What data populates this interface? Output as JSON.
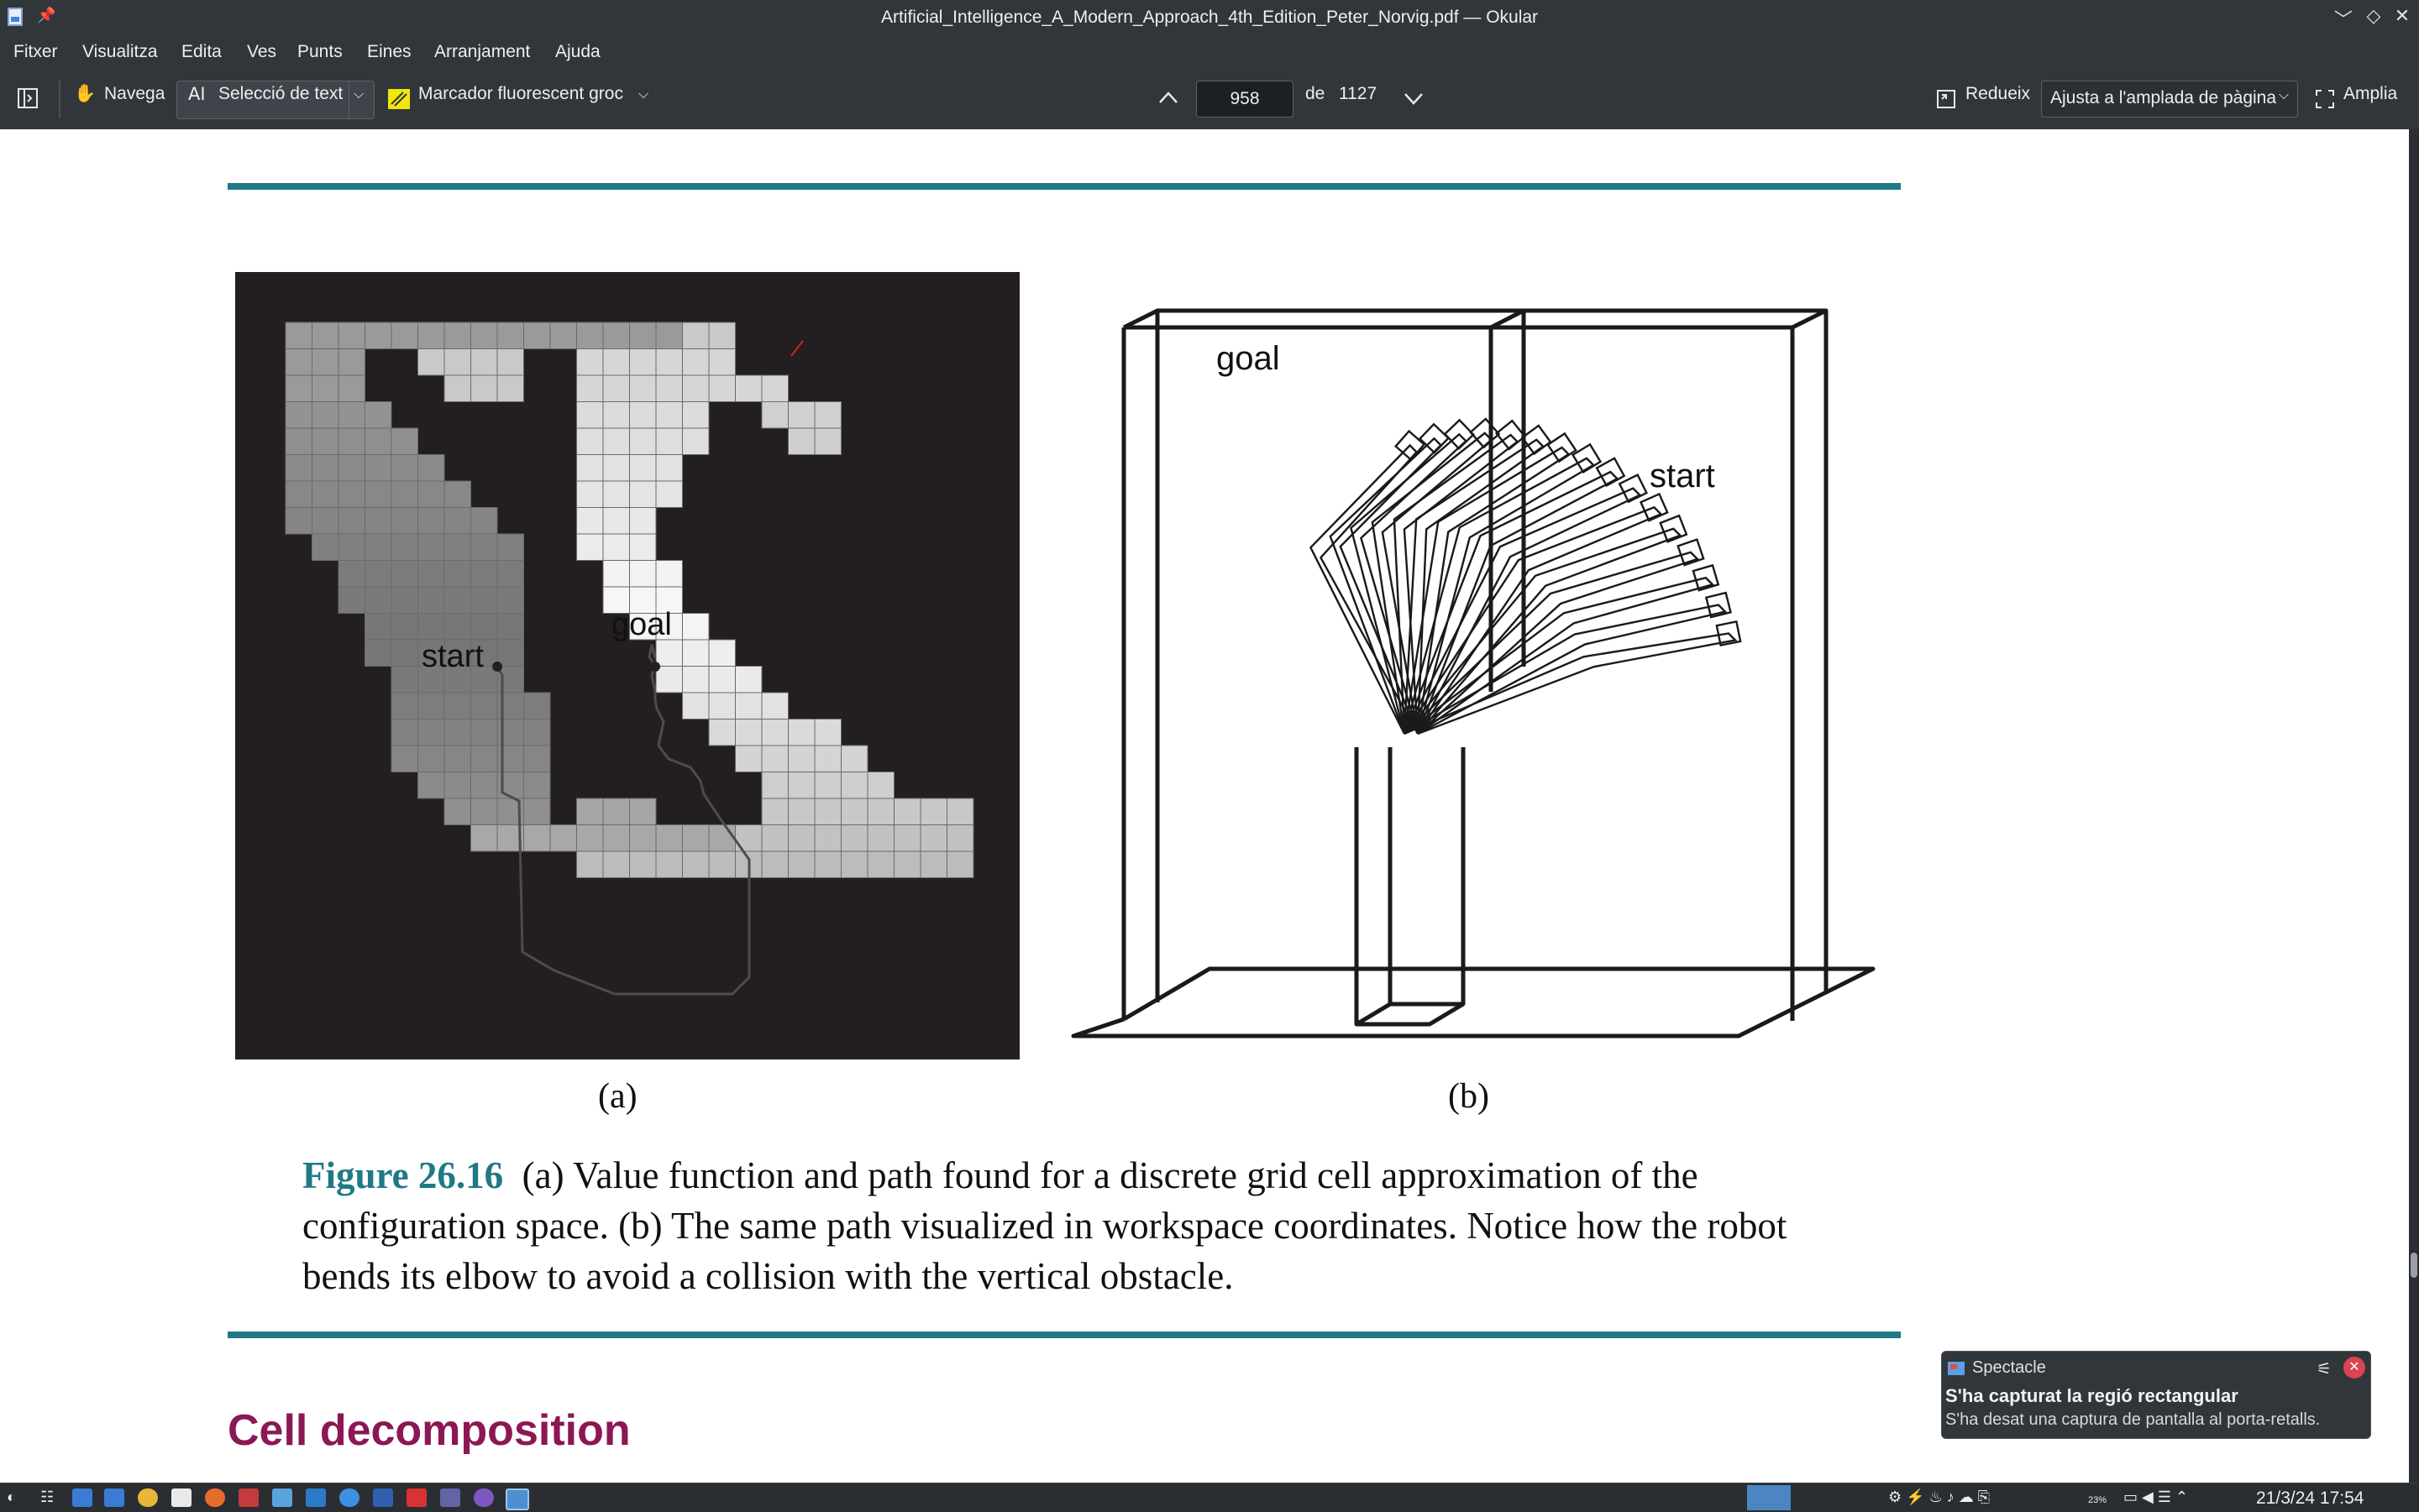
{
  "window": {
    "title": "Artificial_Intelligence_A_Modern_Approach_4th_Edition_Peter_Norvig.pdf — Okular",
    "controls": [
      "minimize",
      "maximize",
      "close"
    ]
  },
  "menu": [
    "Fitxer",
    "Visualitza",
    "Edita",
    "Ves",
    "Punts",
    "Eines",
    "Arranjament",
    "Ajuda"
  ],
  "toolbar": {
    "browse_label": "Navega",
    "text_select_label": "Selecció de text",
    "highlighter_label": "Marcador fluorescent groc",
    "page_current": "958",
    "page_of_label": "de",
    "page_total": "1127",
    "zoom_out_label": "Redueix",
    "zoom_mode": "Ajusta a l'amplada de pàgina",
    "zoom_in_label": "Amplia"
  },
  "document": {
    "panel_a_label": "(a)",
    "panel_b_label": "(b)",
    "fig_a": {
      "start_label": "start",
      "goal_label": "goal"
    },
    "fig_b": {
      "start_label": "start",
      "goal_label": "goal"
    },
    "caption_fig": "Figure 26.16",
    "caption_text": "(a) Value function and path found for a discrete grid cell approximation of the configuration space. (b) The same path visualized in workspace coordinates. Notice how the robot bends its elbow to avoid a collision with the vertical obstacle.",
    "section_title": "Cell decomposition"
  },
  "notification": {
    "app": "Spectacle",
    "title": "S'ha capturat la regió rectangular",
    "body": "S'ha desat una captura de pantalla al porta-retalls."
  },
  "taskbar": {
    "battery": "23%",
    "datetime": "21/3/24  17:54"
  },
  "colors": {
    "accent_teal": "#1f7a84",
    "section_magenta": "#8c1755",
    "chrome": "#31363b"
  }
}
